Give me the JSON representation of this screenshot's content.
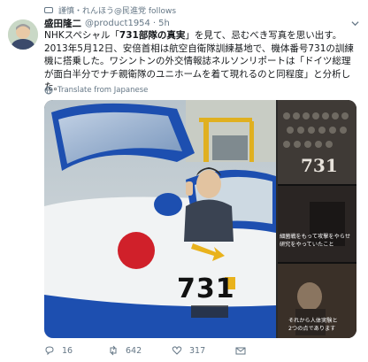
{
  "context": {
    "text": "謹慎・れんほう@民進党 follows"
  },
  "tweet": {
    "display_name": "盛田隆二",
    "handle": "@product1954",
    "separator": "·",
    "time": "5h",
    "body_prefix": "NHKスペシャル「",
    "body_bold": "731部隊の真実",
    "body_suffix": "」を見て、忌むべき写真を思い出す。2013年5月12日、安倍首相は航空自衛隊訓練基地で、機体番号731の訓練機に搭乗した。ワシントンの外交情報誌ネルソンリポートは「ドイツ総理が面白半分でナチ親衛隊のユニホームを着て現れるのと同程度」と分析した。",
    "translate_label": "Translate from Japanese"
  },
  "media": {
    "plane_number": "731",
    "side_overlay_number": "731",
    "caption_middle": "細菌戦をもって攻撃を<br>研究をやっていたこと",
    "caption_middle_l1": "細菌戦をもって攻撃をやらせ",
    "caption_middle_l2": "研究をやっていたこと",
    "caption_bottom_l1": "それから人体実験と",
    "caption_bottom_l2": "2つの点であります"
  },
  "actions": {
    "reply_count": "16",
    "retweet_count": "642",
    "like_count": "317"
  },
  "colors": {
    "secondary_text": "#657786",
    "plane_blue": "#1d4fb0",
    "roundel_red": "#d0202a"
  }
}
